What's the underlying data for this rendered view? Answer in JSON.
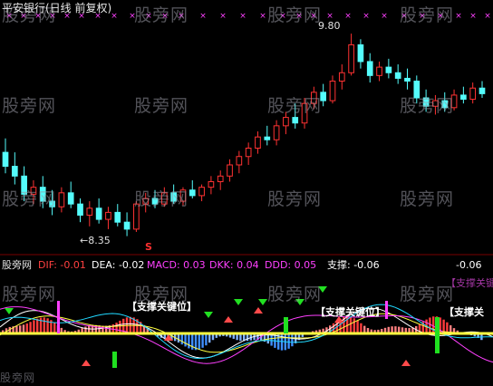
{
  "header": {
    "title": "平安银行(日线 前复权)"
  },
  "watermark": "股旁网",
  "footer_watermark": "股旁网",
  "price_annotations": {
    "high": "9.80",
    "low": "←8.35"
  },
  "indicator_bar": {
    "name": "股旁网",
    "items": [
      {
        "label": "DIF: -0.01",
        "color": "#ff4040"
      },
      {
        "label": "DEA: -0.02",
        "color": "#ffffff"
      },
      {
        "label": "MACD: 0.03",
        "color": "#ff40ff"
      },
      {
        "label": "DKK: 0.04",
        "color": "#ff40ff"
      },
      {
        "label": "DDD: 0.05",
        "color": "#ff40ff"
      },
      {
        "label": "支撑: -0.06",
        "color": "#ffffff"
      }
    ],
    "right_value": "-0.06"
  },
  "signal_label": "【支撑关键位】",
  "signal_label_partial": "【支撑关",
  "signal_label_faint": "【支撑关键位",
  "s_marker": "S",
  "colors": {
    "up": "#ff3232",
    "down": "#54fcfc",
    "zero_line": "#ffff40",
    "green_bar": "#20e020",
    "magenta": "#ff40ff",
    "background": "#000000"
  },
  "chart_data": [
    {
      "type": "candlestick",
      "title": "平安银行(日线 前复权)",
      "high_label": 9.8,
      "low_label": 8.35,
      "ohlc": [
        [
          8.95,
          9.05,
          8.8,
          8.85
        ],
        [
          8.85,
          8.95,
          8.72,
          8.78
        ],
        [
          8.78,
          8.85,
          8.6,
          8.65
        ],
        [
          8.65,
          8.75,
          8.58,
          8.7
        ],
        [
          8.7,
          8.78,
          8.55,
          8.6
        ],
        [
          8.6,
          8.68,
          8.5,
          8.56
        ],
        [
          8.56,
          8.7,
          8.52,
          8.66
        ],
        [
          8.66,
          8.74,
          8.55,
          8.58
        ],
        [
          8.58,
          8.62,
          8.45,
          8.5
        ],
        [
          8.5,
          8.6,
          8.42,
          8.55
        ],
        [
          8.55,
          8.62,
          8.44,
          8.47
        ],
        [
          8.47,
          8.56,
          8.4,
          8.52
        ],
        [
          8.52,
          8.58,
          8.42,
          8.45
        ],
        [
          8.45,
          8.52,
          8.35,
          8.4
        ],
        [
          8.4,
          8.6,
          8.38,
          8.58
        ],
        [
          8.58,
          8.66,
          8.52,
          8.62
        ],
        [
          8.62,
          8.68,
          8.55,
          8.58
        ],
        [
          8.58,
          8.7,
          8.56,
          8.66
        ],
        [
          8.66,
          8.72,
          8.58,
          8.6
        ],
        [
          8.6,
          8.7,
          8.57,
          8.68
        ],
        [
          8.68,
          8.75,
          8.62,
          8.64
        ],
        [
          8.64,
          8.72,
          8.6,
          8.7
        ],
        [
          8.7,
          8.78,
          8.65,
          8.74
        ],
        [
          8.74,
          8.82,
          8.68,
          8.78
        ],
        [
          8.78,
          8.9,
          8.74,
          8.86
        ],
        [
          8.86,
          8.96,
          8.8,
          8.92
        ],
        [
          8.92,
          9.02,
          8.86,
          8.98
        ],
        [
          8.98,
          9.1,
          8.94,
          9.06
        ],
        [
          9.06,
          9.14,
          9.0,
          9.04
        ],
        [
          9.04,
          9.18,
          9.0,
          9.14
        ],
        [
          9.14,
          9.24,
          9.08,
          9.2
        ],
        [
          9.2,
          9.3,
          9.12,
          9.16
        ],
        [
          9.16,
          9.34,
          9.12,
          9.3
        ],
        [
          9.3,
          9.42,
          9.26,
          9.38
        ],
        [
          9.38,
          9.44,
          9.28,
          9.32
        ],
        [
          9.32,
          9.5,
          9.3,
          9.46
        ],
        [
          9.46,
          9.58,
          9.4,
          9.52
        ],
        [
          9.52,
          9.8,
          9.5,
          9.72
        ],
        [
          9.72,
          9.76,
          9.55,
          9.6
        ],
        [
          9.6,
          9.66,
          9.45,
          9.5
        ],
        [
          9.5,
          9.6,
          9.46,
          9.56
        ],
        [
          9.56,
          9.62,
          9.48,
          9.52
        ],
        [
          9.52,
          9.58,
          9.44,
          9.48
        ],
        [
          9.48,
          9.55,
          9.4,
          9.46
        ],
        [
          9.46,
          9.5,
          9.3,
          9.34
        ],
        [
          9.34,
          9.4,
          9.24,
          9.28
        ],
        [
          9.28,
          9.36,
          9.22,
          9.32
        ],
        [
          9.32,
          9.38,
          9.24,
          9.27
        ],
        [
          9.27,
          9.4,
          9.25,
          9.36
        ],
        [
          9.36,
          9.42,
          9.3,
          9.33
        ],
        [
          9.33,
          9.45,
          9.3,
          9.41
        ],
        [
          9.41,
          9.46,
          9.34,
          9.37
        ]
      ]
    },
    {
      "type": "bar",
      "title": "股旁网",
      "series": [
        {
          "name": "DIF",
          "values": [
            -0.01
          ]
        },
        {
          "name": "DEA",
          "values": [
            -0.02
          ]
        },
        {
          "name": "MACD",
          "values": [
            0.03
          ]
        },
        {
          "name": "DKK",
          "values": [
            0.04
          ]
        },
        {
          "name": "DDD",
          "values": [
            0.05
          ]
        },
        {
          "name": "支撑",
          "values": [
            -0.06
          ]
        }
      ]
    }
  ]
}
